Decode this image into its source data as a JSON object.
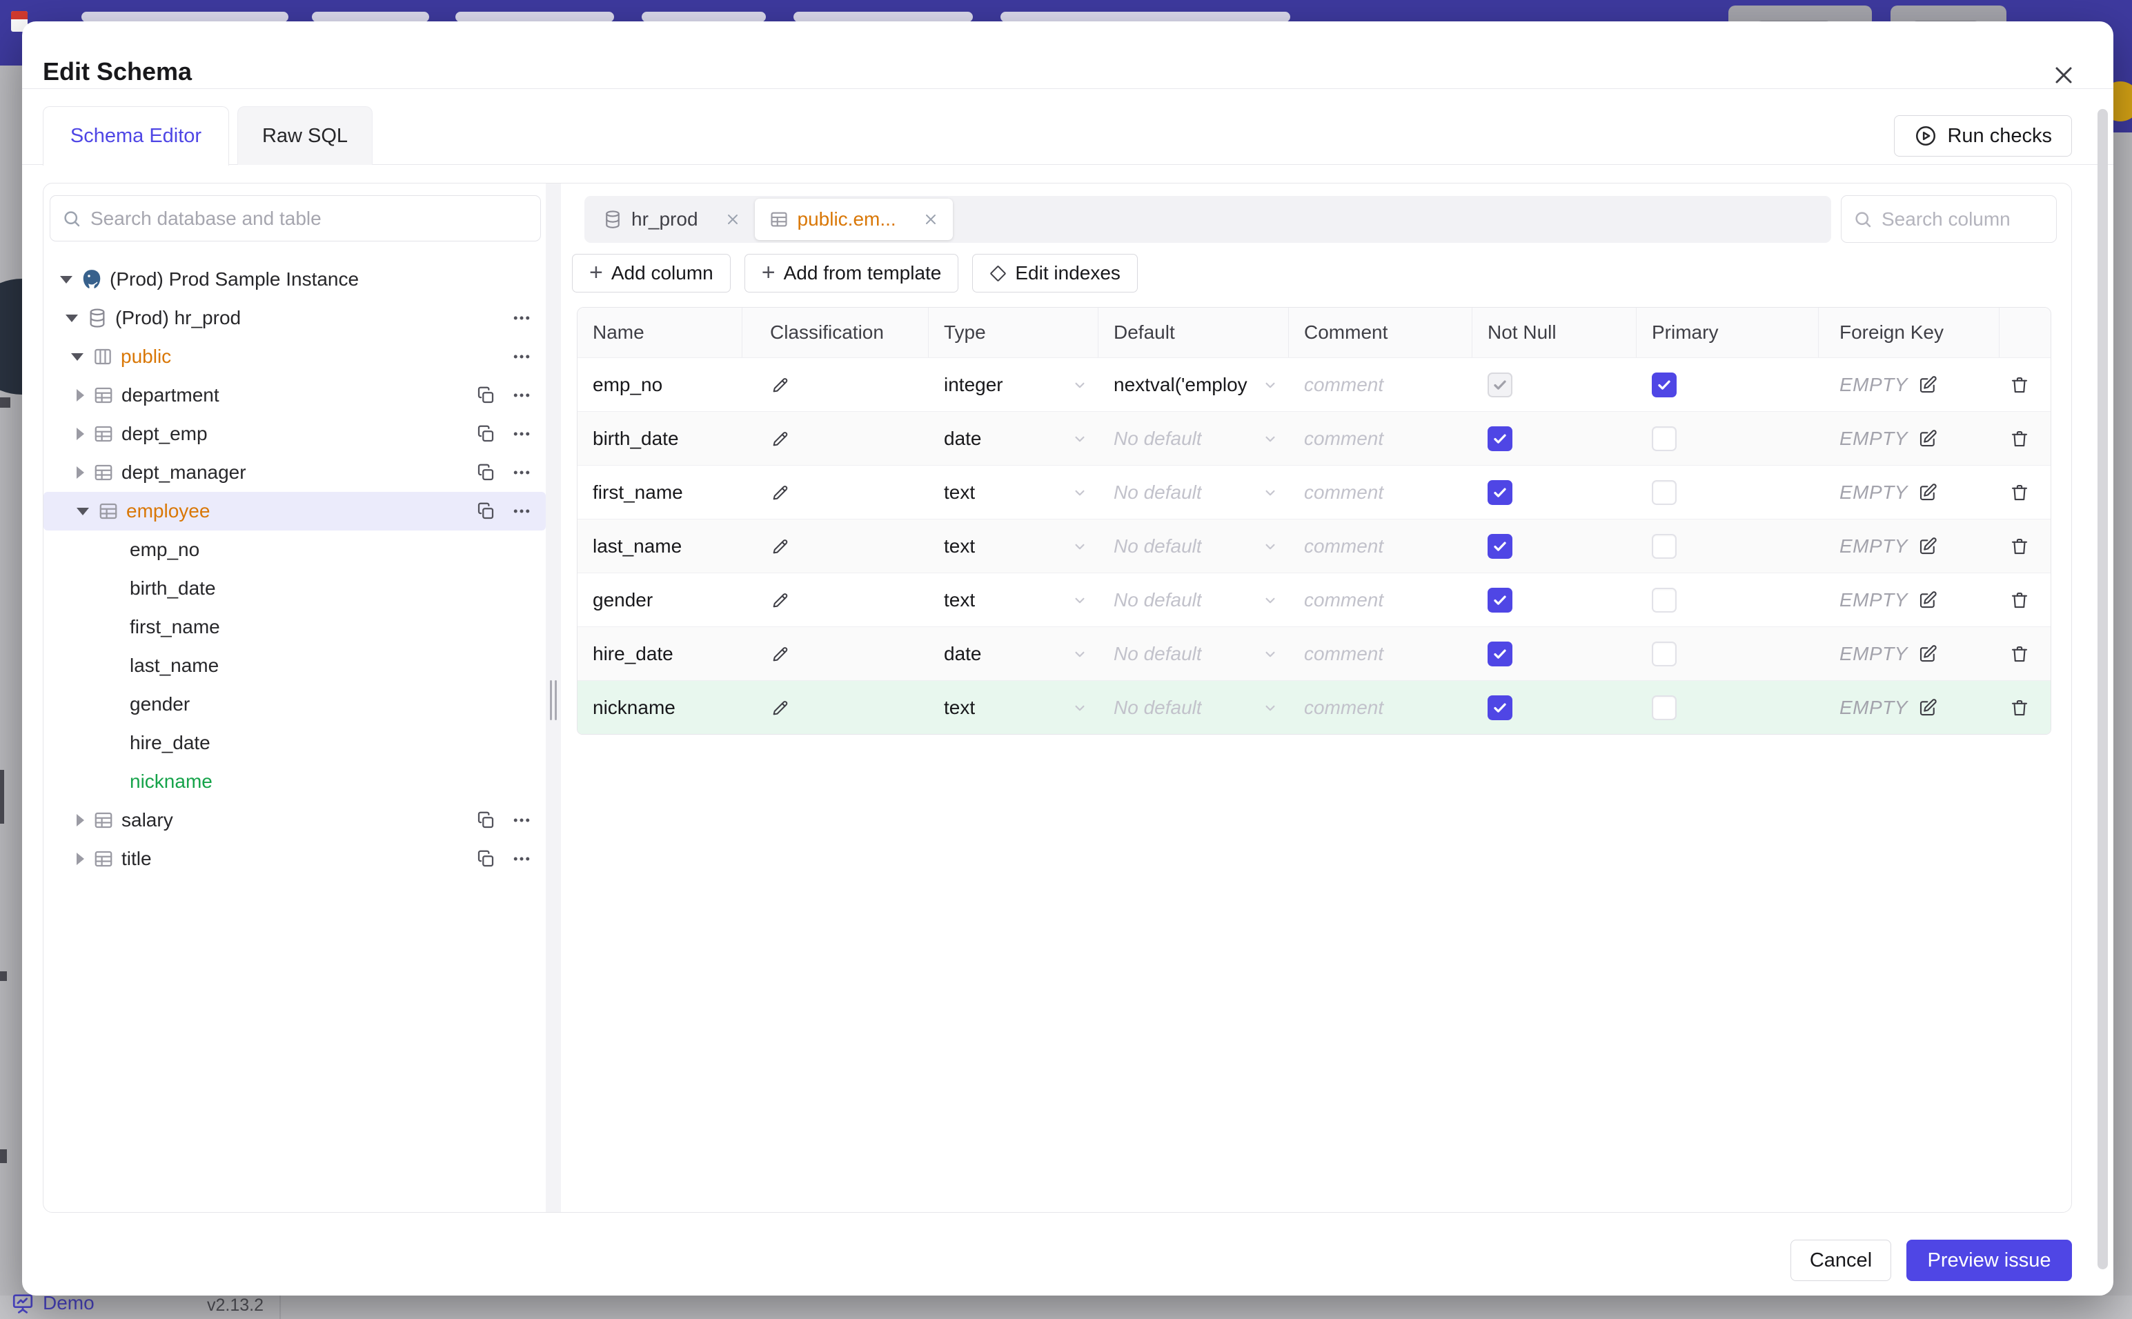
{
  "page": {
    "demo_label": "Demo",
    "version": "v2.13.2"
  },
  "modal": {
    "title": "Edit Schema",
    "tabs": [
      {
        "label": "Schema Editor"
      },
      {
        "label": "Raw SQL"
      }
    ],
    "run_checks_label": "Run checks",
    "sidebar": {
      "search_placeholder": "Search database and table",
      "tree": [
        {
          "level": 0,
          "caret": "down",
          "icon": "postgres",
          "label": "(Prod) Prod Sample Instance"
        },
        {
          "level": 1,
          "caret": "down",
          "icon": "database",
          "label": "(Prod) hr_prod",
          "actions": [
            "more"
          ]
        },
        {
          "level": 2,
          "caret": "down",
          "icon": "schema",
          "label": "public",
          "color": "modified",
          "actions": [
            "more"
          ]
        },
        {
          "level": 3,
          "caret": "right",
          "icon": "table",
          "label": "department",
          "actions": [
            "copy",
            "more"
          ]
        },
        {
          "level": 3,
          "caret": "right",
          "icon": "table",
          "label": "dept_emp",
          "actions": [
            "copy",
            "more"
          ]
        },
        {
          "level": 3,
          "caret": "right",
          "icon": "table",
          "label": "dept_manager",
          "actions": [
            "copy",
            "more"
          ]
        },
        {
          "level": 3,
          "caret": "down",
          "icon": "table",
          "label": "employee",
          "color": "modified",
          "selected": true,
          "actions": [
            "copy",
            "more"
          ]
        },
        {
          "level": 4,
          "label": "emp_no"
        },
        {
          "level": 4,
          "label": "birth_date"
        },
        {
          "level": 4,
          "label": "first_name"
        },
        {
          "level": 4,
          "label": "last_name"
        },
        {
          "level": 4,
          "label": "gender"
        },
        {
          "level": 4,
          "label": "hire_date"
        },
        {
          "level": 4,
          "label": "nickname",
          "color": "new"
        },
        {
          "level": 3,
          "caret": "right",
          "icon": "table",
          "label": "salary",
          "actions": [
            "copy",
            "more"
          ]
        },
        {
          "level": 3,
          "caret": "right",
          "icon": "table",
          "label": "title",
          "actions": [
            "copy",
            "more"
          ]
        }
      ]
    },
    "editor": {
      "chips": [
        {
          "icon": "database",
          "label": "hr_prod"
        },
        {
          "icon": "table",
          "label": "public.em...",
          "active": true
        }
      ],
      "column_search_placeholder": "Search column",
      "toolbar": [
        {
          "icon": "plus",
          "label": "Add column"
        },
        {
          "icon": "plus",
          "label": "Add from template"
        },
        {
          "icon": "diamond",
          "label": "Edit indexes"
        }
      ],
      "table": {
        "headers": [
          "Name",
          "Classification",
          "Type",
          "Default",
          "Comment",
          "Not Null",
          "Primary",
          "Foreign Key"
        ],
        "comment_placeholder": "comment",
        "empty_label": "EMPTY",
        "rows": [
          {
            "name": "emp_no",
            "type": "integer",
            "default": "nextval('employ",
            "default_set": true,
            "not_null_checked": true,
            "not_null_disabled": true,
            "primary_checked": true
          },
          {
            "name": "birth_date",
            "type": "date",
            "default": "No default",
            "not_null_checked": true,
            "primary_checked": false
          },
          {
            "name": "first_name",
            "type": "text",
            "default": "No default",
            "not_null_checked": true,
            "primary_checked": false
          },
          {
            "name": "last_name",
            "type": "text",
            "default": "No default",
            "not_null_checked": true,
            "primary_checked": false
          },
          {
            "name": "gender",
            "type": "text",
            "default": "No default",
            "not_null_checked": true,
            "primary_checked": false
          },
          {
            "name": "hire_date",
            "type": "date",
            "default": "No default",
            "not_null_checked": true,
            "primary_checked": false
          },
          {
            "name": "nickname",
            "type": "text",
            "default": "No default",
            "not_null_checked": true,
            "primary_checked": false,
            "state": "new"
          }
        ]
      }
    },
    "footer": {
      "cancel_label": "Cancel",
      "primary_label": "Preview issue"
    }
  }
}
